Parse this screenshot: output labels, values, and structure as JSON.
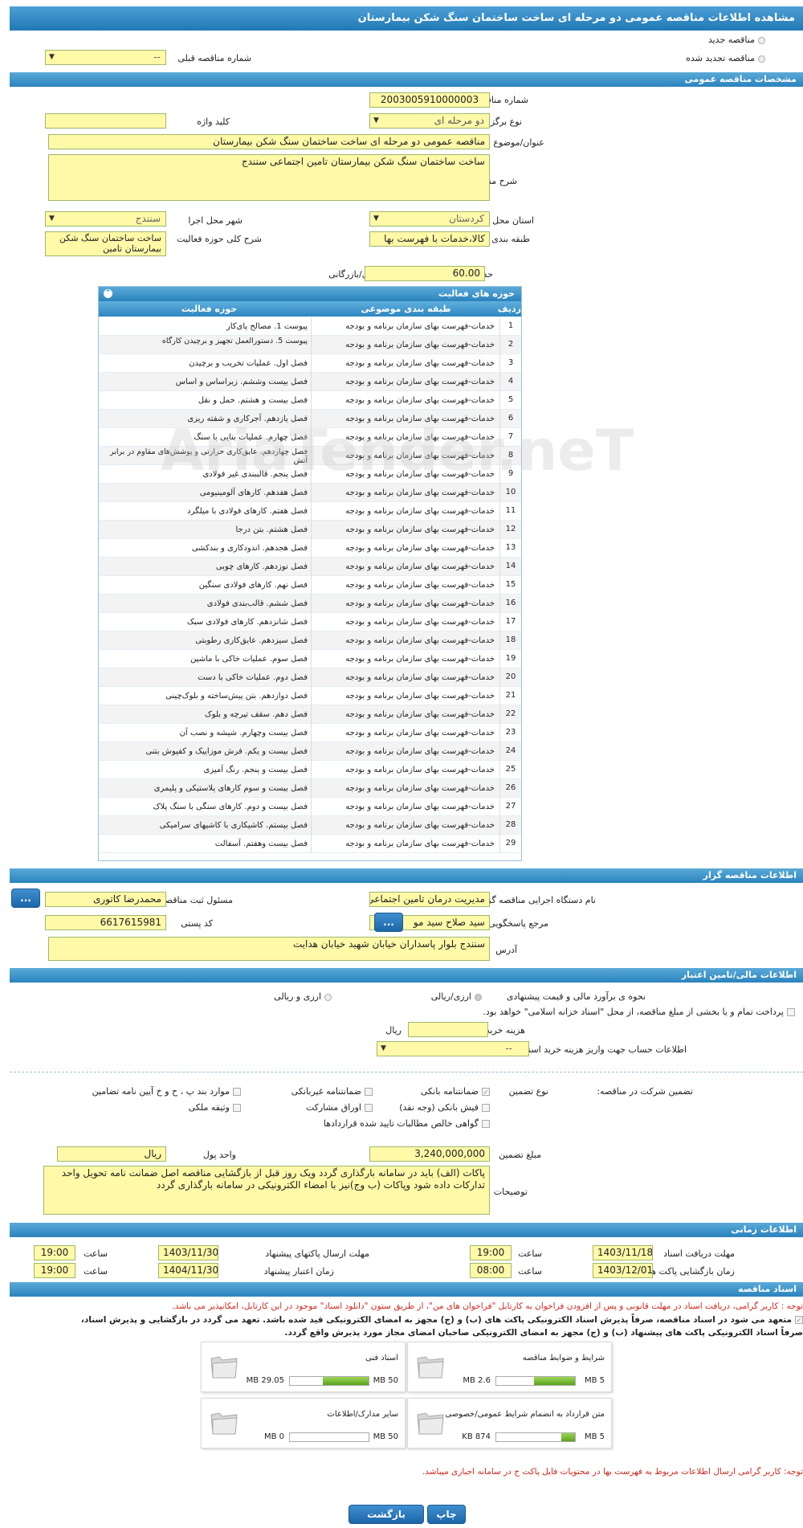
{
  "header": {
    "title": "مشاهده اطلاعات مناقصه عمومی دو مرحله ای ساخت ساختمان سنگ شکن بیمارستان"
  },
  "type_choice": {
    "new": "مناقصه جدید",
    "renewed": "مناقصه تجدید شده",
    "previous_label": "شماره مناقصه قبلی",
    "previous_value": "--"
  },
  "general": {
    "section": "مشخصات مناقصه عمومی",
    "number_label": "شماره مناقصه",
    "number_value": "2003005910000003",
    "holding_label": "نوع برگزاری",
    "holding_value": "دو مرحله ای",
    "keyword_label": "کلید واژه",
    "keyword_value": "",
    "subject_label": "عنوان/موضوع مناقصه",
    "subject_value": "مناقصه عمومی دو مرحله ای ساخت ساختمان سنگ شکن بیمارستان",
    "desc_label": "شرح مناقصه",
    "desc_value": "ساخت ساختمان سنگ شکن بیمارستان تامین اجتماعی سنندج",
    "province_label": "استان محل اجرا",
    "province_value": "کردستان",
    "city_label": "شهر محل اجرا",
    "city_value": "سنندج",
    "category_label": "طبقه بندی موضوعی",
    "category_value": "کالا،خدمات با فهرست بها",
    "scope_label": "شرح کلی حوزه فعالیت",
    "scope_value": "ساخت ساختمان سنگ شکن بیمارستان تامین",
    "score_label": "حداقل امتیاز قابل قبول ارزیابی فنی/بازرگانی",
    "score_value": "60.00"
  },
  "activities": {
    "title": "حوزه های فعالیت",
    "headers": [
      "ردیف",
      "طبقه بندی موضوعی",
      "حوزه فعالیت"
    ],
    "rows": [
      [
        "1",
        "خدمات-فهرست بهای سازمان برنامه و بودجه",
        "پیوست 1. مصالح پای‌کار"
      ],
      [
        "2",
        "خدمات-فهرست بهای سازمان برنامه و بودجه",
        "پیوست 5. دستورالعمل تجهیز و برچیدن کارگاه"
      ],
      [
        "3",
        "خدمات-فهرست بهای سازمان برنامه و بودجه",
        "فصل اول. عملیات تخریب و برچیدن"
      ],
      [
        "4",
        "خدمات-فهرست بهای سازمان برنامه و بودجه",
        "فصل بیست وششم. زیراساس و اساس"
      ],
      [
        "5",
        "خدمات-فهرست بهای سازمان برنامه و بودجه",
        "فصل بیست و هشتم. حمل و نقل"
      ],
      [
        "6",
        "خدمات-فهرست بهای سازمان برنامه و بودجه",
        "فصل یازدهم. آجرکاری و شفته ریزی"
      ],
      [
        "7",
        "خدمات-فهرست بهای سازمان برنامه و بودجه",
        "فصل چهارم. عملیات بنایی با سنگ"
      ],
      [
        "8",
        "خدمات-فهرست بهای سازمان برنامه و بودجه",
        "فصل چهاردهم. عایق‌کاری حرارتی و پوشش‌های مقاوم در برابر آتش"
      ],
      [
        "9",
        "خدمات-فهرست بهای سازمان برنامه و بودجه",
        "فصل پنجم. قالببندی غیر فولادی"
      ],
      [
        "10",
        "خدمات-فهرست بهای سازمان برنامه و بودجه",
        "فصل هفدهم. کارهای آلومینیومی"
      ],
      [
        "11",
        "خدمات-فهرست بهای سازمان برنامه و بودجه",
        "فصل هفتم. کارهای فولادی با میلگرد"
      ],
      [
        "12",
        "خدمات-فهرست بهای سازمان برنامه و بودجه",
        "فصل هشتم. بتن درجا"
      ],
      [
        "13",
        "خدمات-فهرست بهای سازمان برنامه و بودجه",
        "فصل هجدهم. اندودکاری و بندکشی"
      ],
      [
        "14",
        "خدمات-فهرست بهای سازمان برنامه و بودجه",
        "فصل نوزدهم. کارهای چوبی"
      ],
      [
        "15",
        "خدمات-فهرست بهای سازمان برنامه و بودجه",
        "فصل نهم. کارهای فولادی سنگین"
      ],
      [
        "16",
        "خدمات-فهرست بهای سازمان برنامه و بودجه",
        "فصل ششم. قالب‌بندی فولادی"
      ],
      [
        "17",
        "خدمات-فهرست بهای سازمان برنامه و بودجه",
        "فصل شانزدهم. کارهای فولادی سبک"
      ],
      [
        "18",
        "خدمات-فهرست بهای سازمان برنامه و بودجه",
        "فصل سیزدهم. عایق‌کاری رطوبتی"
      ],
      [
        "19",
        "خدمات-فهرست بهای سازمان برنامه و بودجه",
        "فصل سوم. عملیات خاکی با ماشین"
      ],
      [
        "20",
        "خدمات-فهرست بهای سازمان برنامه و بودجه",
        "فصل دوم. عملیات خاکی با دست"
      ],
      [
        "21",
        "خدمات-فهرست بهای سازمان برنامه و بودجه",
        "فصل دوازدهم. بتن پیش‌ساخته و بلوک‌چینی"
      ],
      [
        "22",
        "خدمات-فهرست بهای سازمان برنامه و بودجه",
        "فصل دهم. سقف تیرچه و بلوک"
      ],
      [
        "23",
        "خدمات-فهرست بهای سازمان برنامه و بودجه",
        "فصل بیست وچهارم. شیشه و نصب آن"
      ],
      [
        "24",
        "خدمات-فهرست بهای سازمان برنامه و بودجه",
        "فصل بیست و یکم. فرش موزاییک و کفپوش بتنی"
      ],
      [
        "25",
        "خدمات-فهرست بهای سازمان برنامه و بودجه",
        "فصل بیست و پنجم. رنگ آمیزی"
      ],
      [
        "26",
        "خدمات-فهرست بهای سازمان برنامه و بودجه",
        "فصل بیست و سوم کارهای پلاستیکی و پلیمری"
      ],
      [
        "27",
        "خدمات-فهرست بهای سازمان برنامه و بودجه",
        "فصل بیست و دوم. کارهای سنگی با سنگ پلاک"
      ],
      [
        "28",
        "خدمات-فهرست بهای سازمان برنامه و بودجه",
        "فصل بیستم. کاشیکاری با کاشیهای سرامیکی"
      ],
      [
        "29",
        "خدمات-فهرست بهای سازمان برنامه و بودجه",
        "فصل بیست وهفتم. آسفالت"
      ]
    ]
  },
  "organizer": {
    "section": "اطلاعات مناقصه گزار",
    "org_label": "نام دستگاه اجرایی مناقصه گزار",
    "org_value": "مدیریت درمان تامین اجتماعی",
    "resp_label": "مسئول ثبت مناقصه",
    "resp_value": "محمدرضا کاتوری",
    "ref_label": "مرجع پاسخگویی",
    "ref_value": "سید صلاح سید مو",
    "postal_label": "کد پستی",
    "postal_value": "6617615981",
    "address_label": "آدرس",
    "address_value": "سنندج بلوار پاسداران خیابان شهید خیابان هدایت",
    "btn": "..."
  },
  "finance": {
    "section": "اطلاعات مالی/تامین اعتبار",
    "estimate_label": "نحوه ی برآورد مالی و قیمت پیشنهادی",
    "opt1": "ارزی/ریالی",
    "opt2": "ارزی و ریالی",
    "payment_text": "پرداخت تمام و یا بخشی از مبلغ مناقصه، از محل \"اسناد خزانه اسلامی\" خواهد بود.",
    "doc_cost_label": "هزینه خرید اسناد",
    "doc_cost_unit": "ریال",
    "account_label": "اطلاعات حساب جهت واریز هزینه خرید اسناد",
    "account_value": "--",
    "guarantee_label": "تضمین شرکت در مناقصه:",
    "gtype_label": "نوع تضمین",
    "g1": "ضمانتنامه بانکی",
    "g2": "ضمانتنامه غیربانکی",
    "g3": "موارد بند پ ، ح و خ آیین نامه تضامین",
    "g4": "فیش بانکی (وجه نقد)",
    "g5": "اوراق مشارکت",
    "g6": "وثیقه ملکی",
    "g7": "گواهی خالص مطالبات تایید شده قراردادها",
    "amount_label": "مبلغ تضمین",
    "amount_value": "3,240,000,000",
    "currency_label": "واحد پول",
    "currency_value": "ریال",
    "notes_label": "توضیحات",
    "notes_value": "پاکات (الف) باید در سامانه بارگذاری گردد ویک روز قبل از بازگشایی مناقصه اصل ضمانت نامه تحویل واحد تدارکات داده شود وپاکات (ب وج)نیز با امضاء الکترونیکی در سامانه بارگذاری گردد"
  },
  "timing": {
    "section": "اطلاعات زمانی",
    "receive_label": "مهلت دریافت اسناد",
    "receive_date": "1403/11/18",
    "receive_time": "19:00",
    "send_label": "مهلت ارسال پاکتهای پیشنهاد",
    "send_date": "1403/11/30",
    "send_time": "19:00",
    "open_label": "زمان بازگشایی پاکت ها",
    "open_date": "1403/12/01",
    "open_time": "08:00",
    "valid_label": "زمان اعتبار پیشنهاد",
    "valid_date": "1404/11/30",
    "valid_time": "19:00",
    "time_label": "ساعت"
  },
  "docs": {
    "section": "اسناد مناقصه",
    "note1": "توجه : کاربر گرامی، دریافت اسناد در مهلت قانونی و پس از افزودن فراخوان به کارتابل \"فراخوان های من\"، از طریق ستون \"دانلود اسناد\" موجود در این کارتابل، امکانپذیر می باشد.",
    "note2": "متعهد می شود در اسناد مناقصه، صرفاً پذیرش اسناد الکترونیکی پاکت های (ب) و (ج) مجهز به امضای الکترونیکی قید شده باشد. تعهد می گردد در بازگشایی و پذیرش اسناد،",
    "note3": "صرفاً اسناد الکترونیکی پاکت های پیشنهاد (ب) و (ج) مجهز به امضای الکترونیکی صاحبان امضای مجاز مورد پذیرش واقع گردد.",
    "items": [
      {
        "title": "شرایط و ضوابط مناقصه",
        "current": "2.6 MB",
        "max": "5 MB",
        "ratio": 0.52
      },
      {
        "title": "اسناد فنی",
        "current": "29.05 MB",
        "max": "50 MB",
        "ratio": 0.58
      },
      {
        "title": "متن قرارداد به انضمام شرایط عمومی/خصوصی",
        "current": "874 KB",
        "max": "5 MB",
        "ratio": 0.17
      },
      {
        "title": "سایر مدارک/اطلاعات",
        "current": "0 MB",
        "max": "50 MB",
        "ratio": 0.0
      }
    ],
    "footer_note": "توجه: کاربر گرامی ارسال اطلاعات مربوط به فهرست بها در محتویات فایل پاکت ج در سامانه اجباری میباشد."
  },
  "buttons": {
    "print": "چاپ",
    "back": "بازگشت"
  },
  "watermark": "AriaTender.neT"
}
